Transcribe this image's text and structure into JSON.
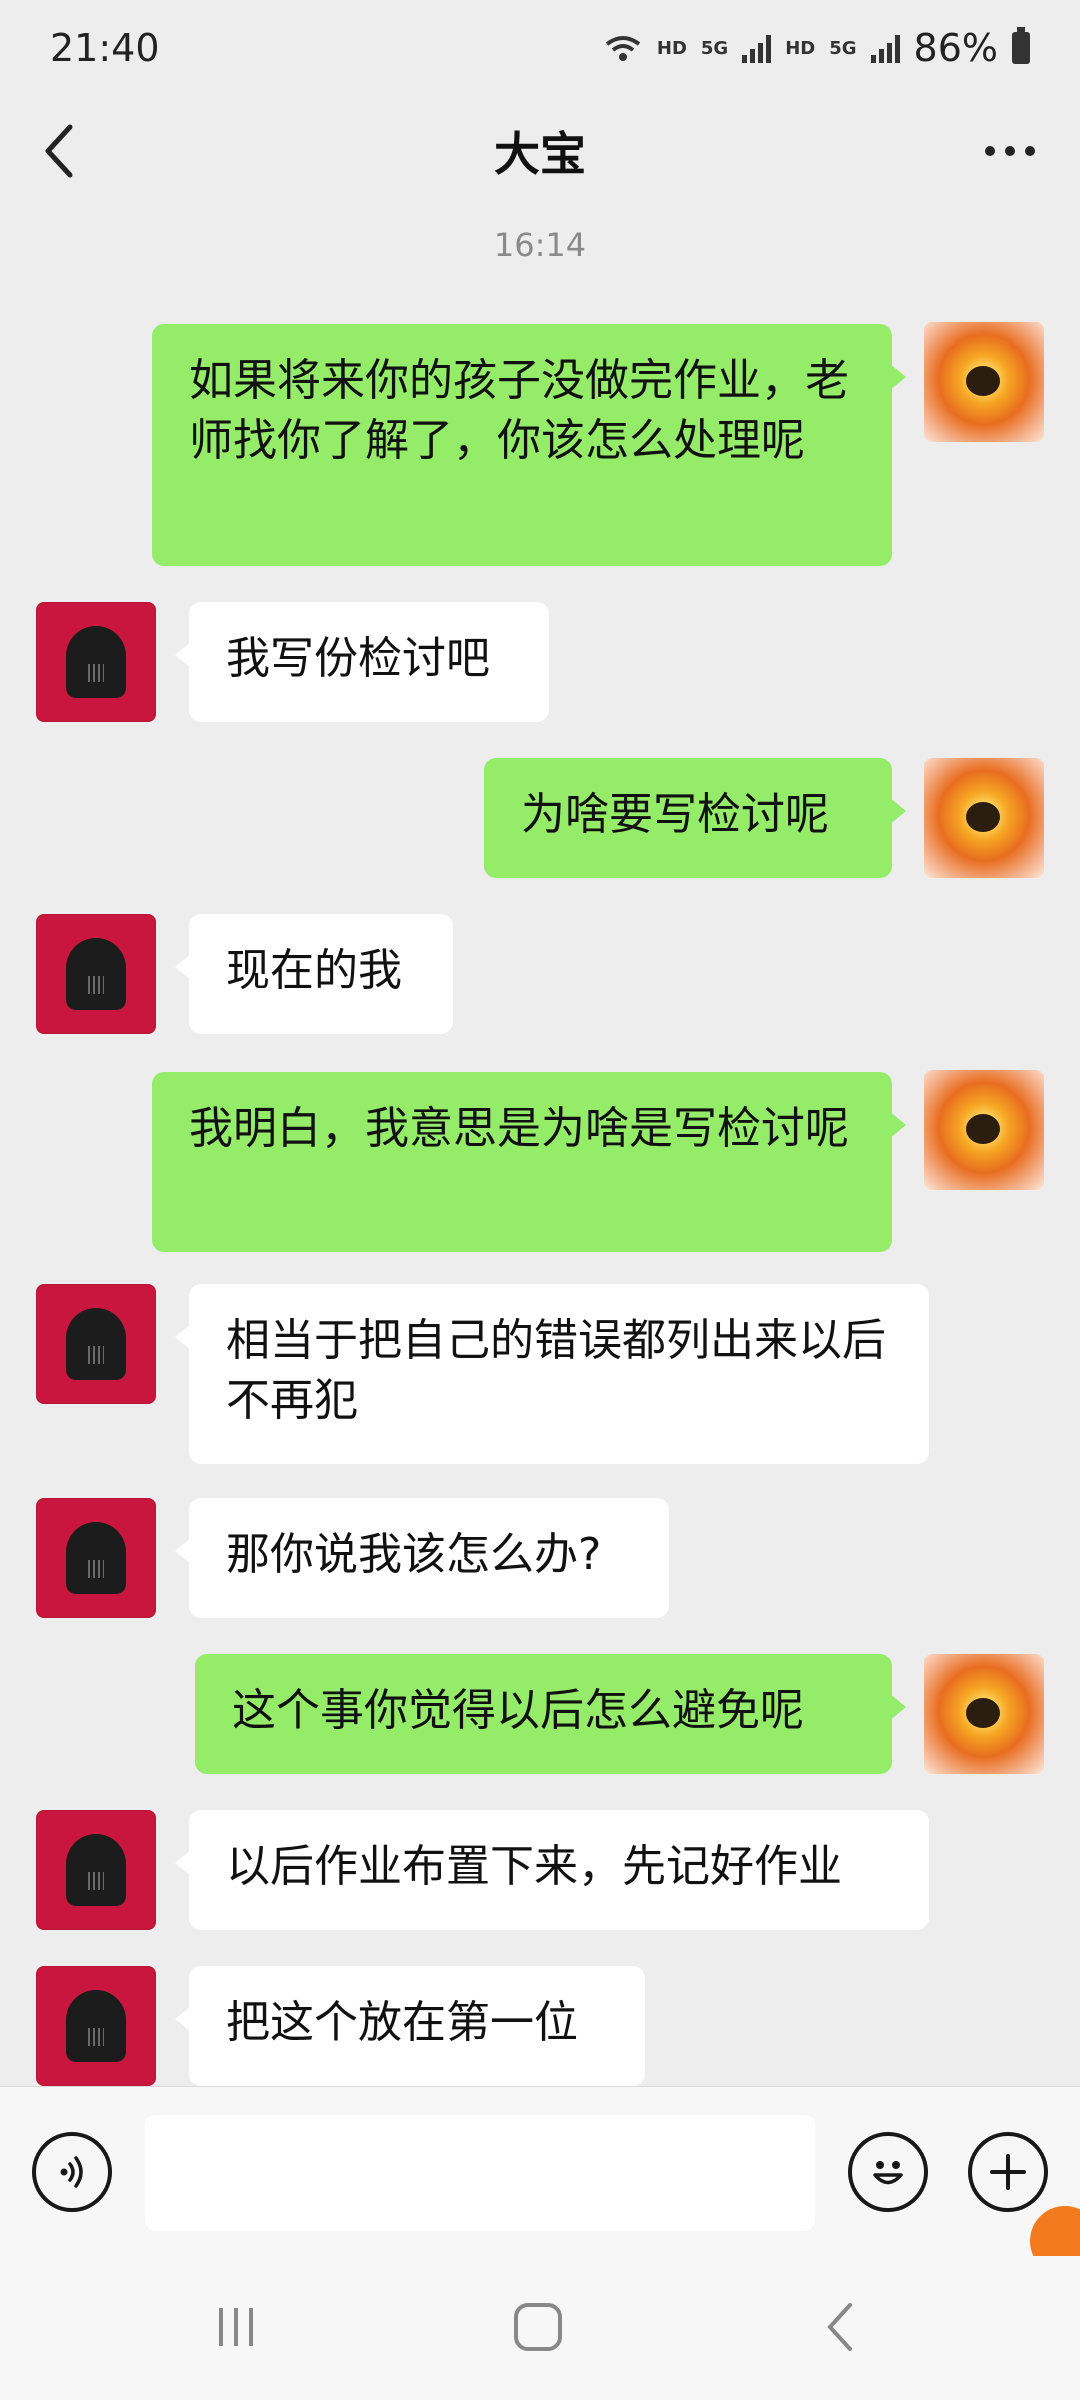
{
  "status_bar": {
    "time": "21:40",
    "network_1": "HD",
    "network_2": "5G",
    "network_3": "HD",
    "network_4": "5G",
    "battery": "86%"
  },
  "header": {
    "title": "大宝"
  },
  "chat": {
    "timestamp": "16:14",
    "messages": [
      {
        "from": "self",
        "text": "如果将来你的孩子没做完作业，老师找你了解了，你该怎么处理呢"
      },
      {
        "from": "other",
        "text": "我写份检讨吧"
      },
      {
        "from": "self",
        "text": "为啥要写检讨呢"
      },
      {
        "from": "other",
        "text": "现在的我"
      },
      {
        "from": "self",
        "text": "我明白，我意思是为啥是写检讨呢"
      },
      {
        "from": "other",
        "text": "相当于把自己的错误都列出来以后不再犯"
      },
      {
        "from": "other",
        "text": "那你说我该怎么办?"
      },
      {
        "from": "self",
        "text": "这个事你觉得以后怎么避免呢"
      },
      {
        "from": "other",
        "text": "以后作业布置下来，先记好作业"
      },
      {
        "from": "other",
        "text": "把这个放在第一位"
      }
    ]
  },
  "input_bar": {
    "message_value": ""
  },
  "colors": {
    "self_bubble": "#95ec69",
    "other_bubble": "#ffffff",
    "chat_background": "#ededed",
    "other_avatar": "#c8163e"
  },
  "icons": [
    "back-arrow-icon",
    "more-dots-icon",
    "voice-icon",
    "emoji-icon",
    "plus-icon",
    "recent-apps-icon",
    "home-icon",
    "back-nav-icon"
  ]
}
